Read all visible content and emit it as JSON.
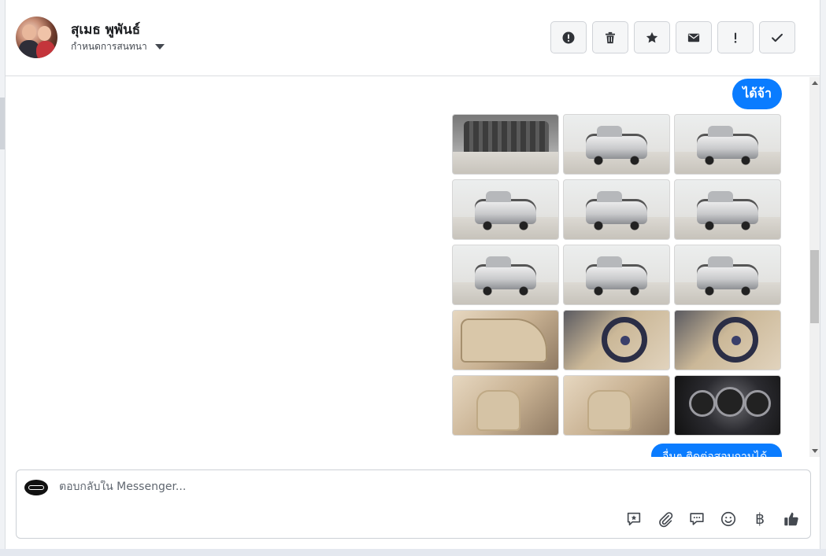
{
  "header": {
    "contact_name": "สุเมธ พูพันธ์",
    "conversation_setting": "กำหนดการสนทนา",
    "actions": [
      {
        "name": "report-button",
        "icon": "alert-circle-icon"
      },
      {
        "name": "delete-button",
        "icon": "trash-icon"
      },
      {
        "name": "star-button",
        "icon": "star-icon"
      },
      {
        "name": "mark-unread-button",
        "icon": "envelope-icon"
      },
      {
        "name": "mark-important-button",
        "icon": "exclamation-icon"
      },
      {
        "name": "mark-done-button",
        "icon": "checkmark-icon"
      }
    ]
  },
  "messages": {
    "reply_bubble": "ได้จ้า",
    "photos": [
      {
        "subject": "engine-bay",
        "kind": "engine"
      },
      {
        "subject": "front-view",
        "kind": "car"
      },
      {
        "subject": "front-view",
        "kind": "car"
      },
      {
        "subject": "front-left-view",
        "kind": "car"
      },
      {
        "subject": "rear-right-view",
        "kind": "car"
      },
      {
        "subject": "rear-view",
        "kind": "car"
      },
      {
        "subject": "rear-left-view",
        "kind": "car"
      },
      {
        "subject": "side-view",
        "kind": "car"
      },
      {
        "subject": "wheel-closeup",
        "kind": "car"
      },
      {
        "subject": "door-interior",
        "kind": "door"
      },
      {
        "subject": "dashboard-steering",
        "kind": "wheel"
      },
      {
        "subject": "steering-wheel",
        "kind": "wheel"
      },
      {
        "subject": "front-seats",
        "kind": "seat"
      },
      {
        "subject": "rear-seat",
        "kind": "seat"
      },
      {
        "subject": "gauge-cluster",
        "kind": "gauge"
      }
    ],
    "partial_bubble": "อื่นๆ ติดต่อสอบถามได้"
  },
  "composer": {
    "placeholder": "ตอบกลับใน Messenger...",
    "tools": [
      {
        "name": "saved-reply-button",
        "icon": "saved-reply-icon"
      },
      {
        "name": "attach-button",
        "icon": "paperclip-icon"
      },
      {
        "name": "quick-reply-button",
        "icon": "chat-bubble-icon"
      },
      {
        "name": "emoji-button",
        "icon": "smiley-icon"
      },
      {
        "name": "payment-button",
        "icon": "baht-icon",
        "symbol": "฿"
      },
      {
        "name": "like-button",
        "icon": "thumbs-up-icon"
      }
    ]
  },
  "colors": {
    "accent": "#0a7cff",
    "border": "#dadde1"
  }
}
